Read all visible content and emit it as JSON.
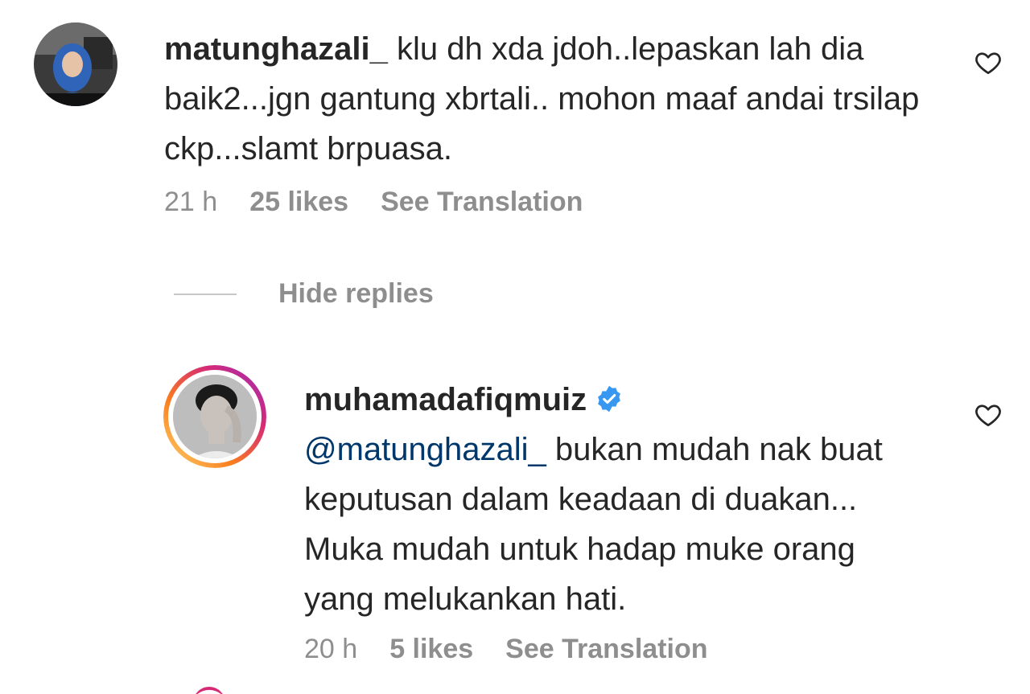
{
  "comment": {
    "username": "matunghazali_",
    "text": "klu dh xda jdoh..lepaskan lah dia baik2...jgn gantung xbrtali.. mohon maaf andai trsilap ckp...slamt brpuasa.",
    "time": "21 h",
    "likes": "25 likes",
    "translate": "See Translation",
    "heart_icon": "heart-outline-icon"
  },
  "replies_toggle": {
    "label": "Hide replies"
  },
  "reply": {
    "username": "muhamadafiqmuiz",
    "verified_icon": "verified-badge-icon",
    "mention": "@matunghazali_",
    "text": "bukan mudah nak buat keputusan dalam keadaan di duakan... Muka mudah untuk hadap muke orang yang melukankan hati.",
    "time": "20 h",
    "likes": "5 likes",
    "translate": "See Translation",
    "heart_icon": "heart-outline-icon"
  },
  "colors": {
    "text": "#262626",
    "secondary": "#8e8e8e",
    "mention": "#00376b",
    "verified": "#3897f0",
    "story_ring_start": "#feda75",
    "story_ring_end": "#d62976"
  }
}
